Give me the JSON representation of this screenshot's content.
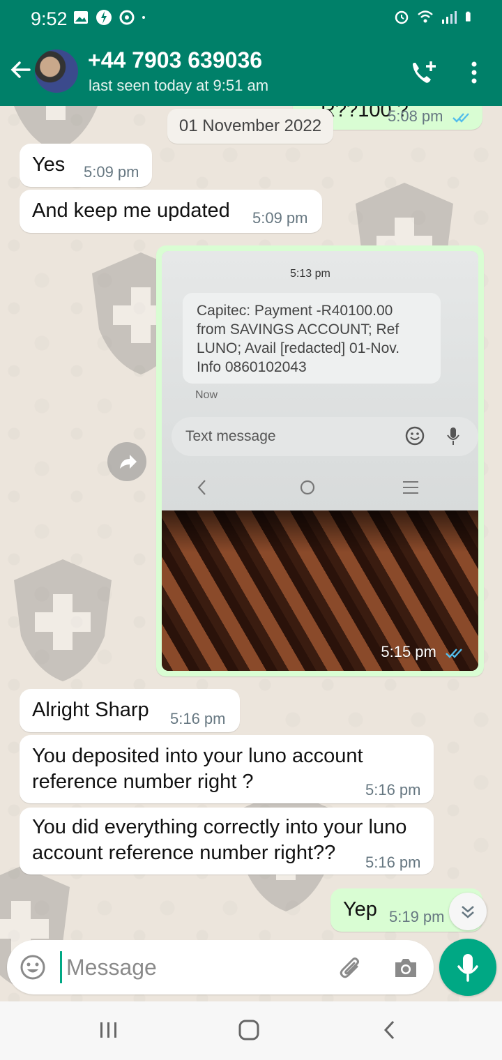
{
  "status_bar": {
    "time": "9:52"
  },
  "contact": {
    "name": "+44 7903 639036",
    "last_seen": "last seen today at 9:51 am"
  },
  "partial_message": {
    "text": "R??100 ?",
    "time": "5:08 pm"
  },
  "date_chip": "01 November 2022",
  "messages": [
    {
      "direction": "in",
      "text": "Yes",
      "time": "5:09 pm"
    },
    {
      "direction": "in",
      "text": "And keep me updated",
      "time": "5:09 pm"
    },
    {
      "direction": "out",
      "type": "image",
      "time": "5:15 pm"
    },
    {
      "direction": "in",
      "text": "Alright Sharp",
      "time": "5:16 pm"
    },
    {
      "direction": "in",
      "text_lines": [
        "You deposited into your luno account",
        "reference number right ?"
      ],
      "time": "5:16 pm"
    },
    {
      "direction": "in",
      "text_lines": [
        "You did everything correctly into your luno",
        "account reference number right??"
      ],
      "time": "5:16 pm"
    },
    {
      "direction": "out",
      "text": "Yep",
      "time": "5:19 pm"
    }
  ],
  "image_content": {
    "sms_time": "5:13 pm",
    "sms_lines": [
      "Capitec: Payment -R40100.00",
      "from SAVINGS ACCOUNT; Ref",
      "LUNO; Avail [redacted] 01-Nov.",
      "Info 0860102043"
    ],
    "sms_now": "Now",
    "sms_input_placeholder": "Text message"
  },
  "composer": {
    "placeholder": "Message"
  },
  "colors": {
    "header": "#008069",
    "outgoing_bubble": "#d9fdd3",
    "incoming_bubble": "#ffffff",
    "accent": "#00a884",
    "read_ticks": "#53bdeb"
  },
  "icons": [
    "back-arrow-icon",
    "add-call-icon",
    "more-vert-icon",
    "forward-icon",
    "emoji-icon",
    "attach-icon",
    "camera-icon",
    "mic-icon",
    "scroll-down-icon"
  ]
}
